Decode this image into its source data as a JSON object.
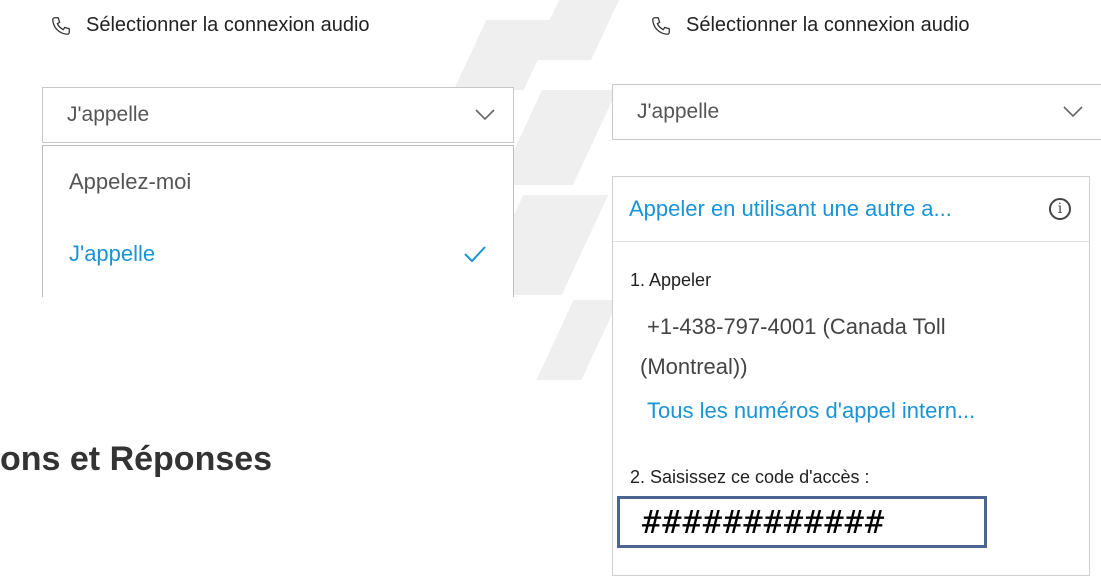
{
  "left_panel": {
    "title": "Sélectionner la connexion audio",
    "select_value": "J'appelle",
    "options": [
      {
        "label": "Appelez-moi",
        "selected": false
      },
      {
        "label": "J'appelle",
        "selected": true
      }
    ]
  },
  "slide_heading": "ons et Réponses",
  "right_panel": {
    "title": "Sélectionner la connexion audio",
    "select_value": "J'appelle",
    "alt_call_link": "Appeler en utilisant une autre a...",
    "step1_label": "1. Appeler",
    "phone_line1": "+1-438-797-4001 (Canada Toll",
    "phone_line2": "(Montreal))",
    "all_numbers_link": "Tous les numéros d'appel intern...",
    "step2_label": "2. Saisissez ce code d'accès :",
    "access_code": "############"
  },
  "colors": {
    "accent_blue": "#1a94d6",
    "code_border": "#4a6690"
  },
  "icons": [
    "phone-icon",
    "chevron-down-icon",
    "checkmark-icon",
    "info-icon"
  ]
}
